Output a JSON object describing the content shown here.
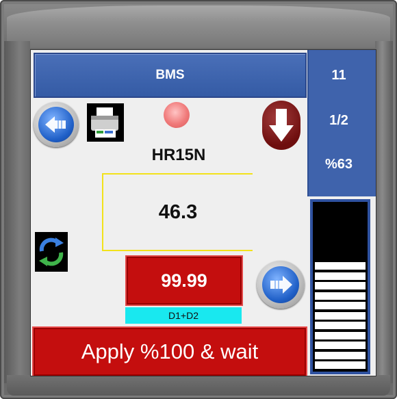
{
  "header": {
    "title": "BMS"
  },
  "side_panel": {
    "value_1": "11",
    "value_2": "1/2",
    "value_3": "%63"
  },
  "device": {
    "name": "HR15N"
  },
  "readout": {
    "value": "46.3"
  },
  "setpoint": {
    "value": "99.99",
    "label": "D1+D2"
  },
  "actions": {
    "apply_label": "Apply %100 & wait"
  },
  "bargraph": {
    "filled_segments": 11,
    "total_segments": 11
  },
  "icons": {
    "prev": "arrow-left-icon",
    "next": "arrow-right-icon",
    "down": "arrow-down-icon",
    "printer": "printer-icon",
    "refresh": "refresh-icon",
    "status": "status-led-icon"
  },
  "colors": {
    "title_bar": "#345ba5",
    "side_panel": "#3f63ac",
    "alarm_red": "#c40e0e",
    "label_cyan": "#19e8ef",
    "value_border": "#f2e21a",
    "led": "#f07a7a"
  }
}
